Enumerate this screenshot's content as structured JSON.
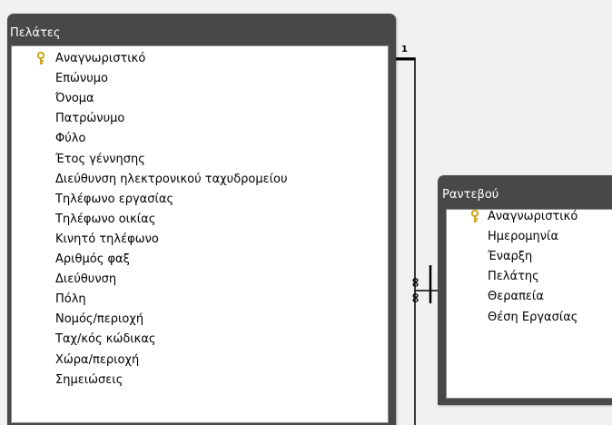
{
  "tables": {
    "clients": {
      "title": "Πελάτες",
      "fields": [
        {
          "label": "Αναγνωριστικό",
          "is_key": true
        },
        {
          "label": "Επώνυμο",
          "is_key": false
        },
        {
          "label": "Όνομα",
          "is_key": false
        },
        {
          "label": "Πατρώνυμο",
          "is_key": false
        },
        {
          "label": "Φύλο",
          "is_key": false
        },
        {
          "label": "Έτος γέννησης",
          "is_key": false
        },
        {
          "label": "Διεύθυνση ηλεκτρονικού ταχυδρομείου",
          "is_key": false
        },
        {
          "label": "Τηλέφωνο εργασίας",
          "is_key": false
        },
        {
          "label": "Τηλέφωνο οικίας",
          "is_key": false
        },
        {
          "label": "Κινητό τηλέφωνο",
          "is_key": false
        },
        {
          "label": "Αριθμός φαξ",
          "is_key": false
        },
        {
          "label": "Διεύθυνση",
          "is_key": false
        },
        {
          "label": "Πόλη",
          "is_key": false
        },
        {
          "label": "Νομός/περιοχή",
          "is_key": false
        },
        {
          "label": "Ταχ/κός κώδικας",
          "is_key": false
        },
        {
          "label": "Χώρα/περιοχή",
          "is_key": false
        },
        {
          "label": "Σημειώσεις",
          "is_key": false
        }
      ]
    },
    "appointments": {
      "title": "Ραντεβού",
      "fields": [
        {
          "label": "Αναγνωριστικό",
          "is_key": true
        },
        {
          "label": "Ημερομηνία",
          "is_key": false
        },
        {
          "label": "Έναρξη",
          "is_key": false
        },
        {
          "label": "Πελάτης",
          "is_key": false
        },
        {
          "label": "Θεραπεία",
          "is_key": false
        },
        {
          "label": "Θέση Εργασίας",
          "is_key": false
        }
      ]
    }
  },
  "relationship": {
    "one_side_label": "1",
    "many_side_label": "∞",
    "line_color": "#000000"
  },
  "colors": {
    "background": "#f1f1f1",
    "table_header": "#484848",
    "key_icon": "#c9a10a"
  }
}
